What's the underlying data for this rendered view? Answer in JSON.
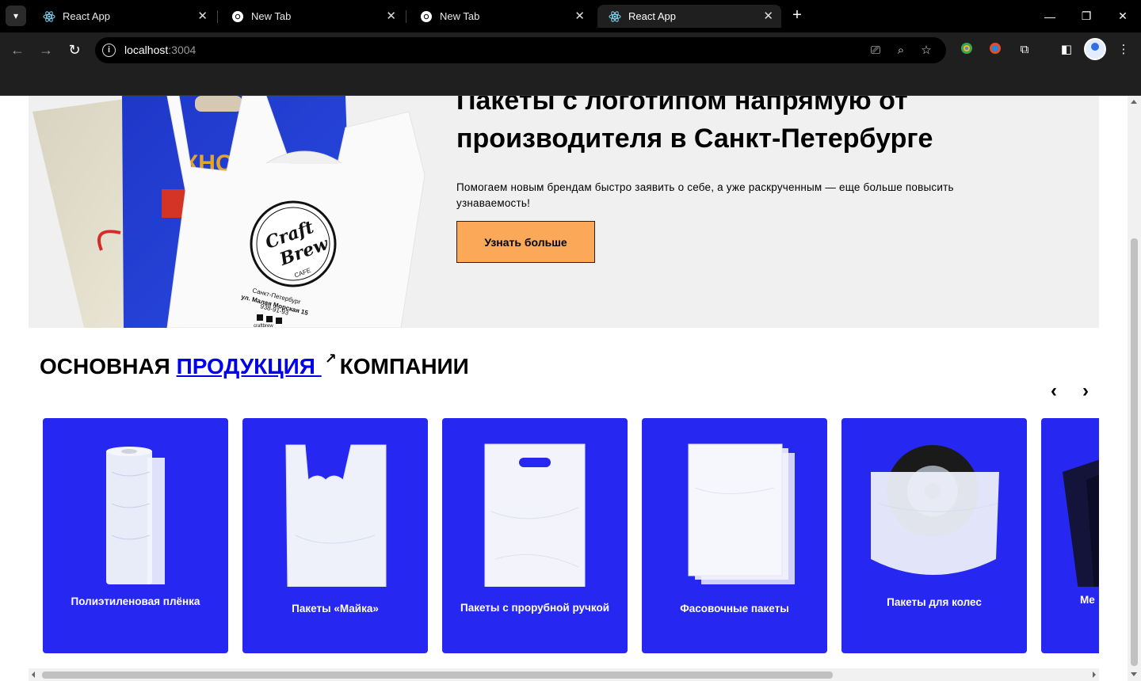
{
  "browser": {
    "tabs": [
      {
        "title": "React App",
        "icon": "react-icon"
      },
      {
        "title": "New Tab",
        "icon": "chrome-icon"
      },
      {
        "title": "New Tab",
        "icon": "chrome-icon"
      },
      {
        "title": "React App",
        "icon": "react-icon"
      }
    ],
    "url_host": "localhost",
    "url_port": ":3004"
  },
  "hero": {
    "title": "Пакеты с логотипом напрямую от производителя в Санкт-Петербурге",
    "subtitle": "Помогаем новым брендам быстро заявить о себе, а уже раскрученным — еще больше повысить узнаваемость!",
    "button": "Узнать больше",
    "bag_text": {
      "brand_line1": "Craft",
      "brand_line2": "Brew",
      "brand_line3": "CAFE",
      "city": "Санкт-Петербург",
      "address": "ул. Малая Морская 15",
      "phone": "938-91-93",
      "site": "craftbrew",
      "blue_bag_text": "КНС"
    }
  },
  "section": {
    "title_before": "ОСНОВНАЯ ",
    "title_link": "ПРОДУКЦИЯ ",
    "title_after": "КОМПАНИИ",
    "prev": "‹",
    "next": "›"
  },
  "products": [
    {
      "label": "Полиэтиленовая плёнка"
    },
    {
      "label": "Пакеты «Майка»"
    },
    {
      "label": "Пакеты с прорубной ручкой"
    },
    {
      "label": "Фасовочные пакеты"
    },
    {
      "label": "Пакеты для колес"
    },
    {
      "label": "Ме"
    }
  ],
  "colors": {
    "card_blue": "#2727f2",
    "button_orange": "#fba959",
    "hero_bg": "#f0f0f0"
  }
}
